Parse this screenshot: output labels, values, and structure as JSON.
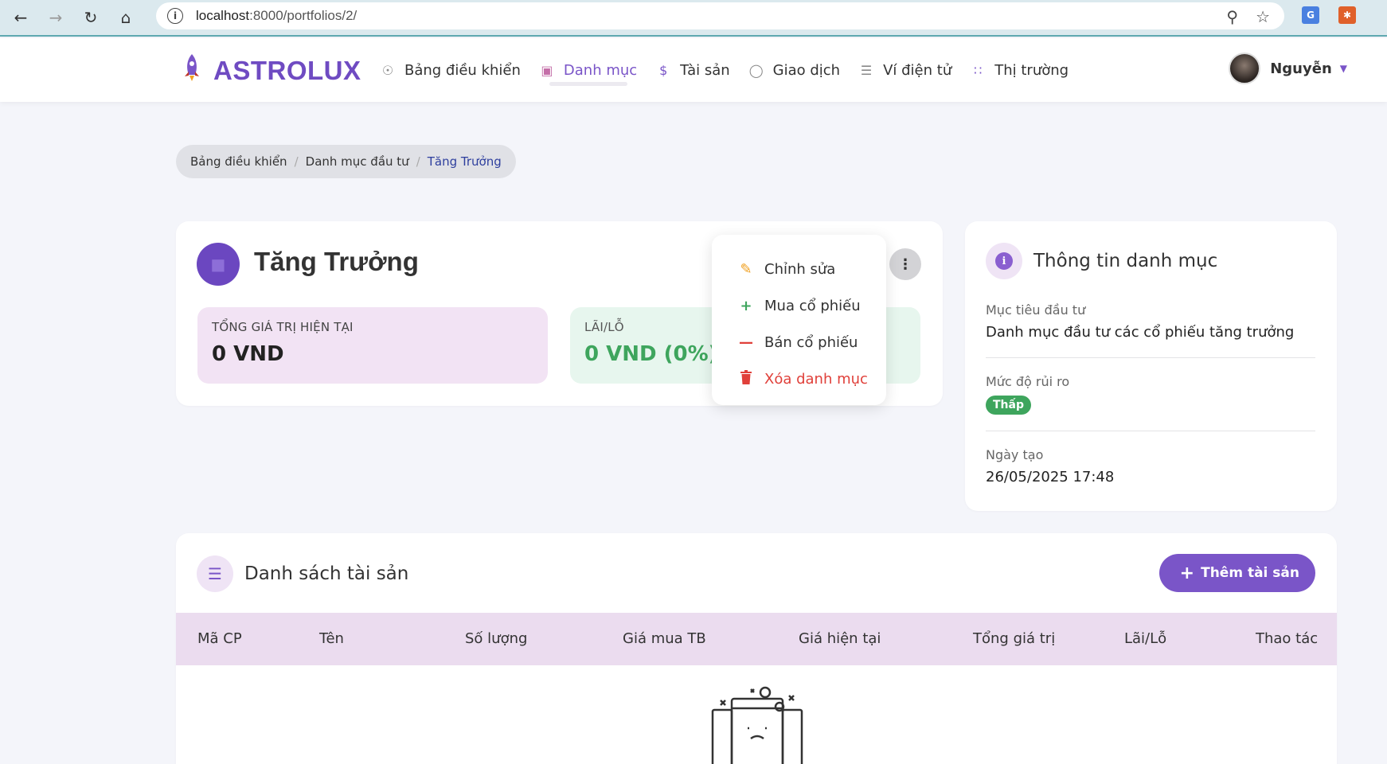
{
  "browser": {
    "url_host": "localhost",
    "url_rest": ":8000/portfolios/2/",
    "back_icon": "arrow-left-icon",
    "forward_icon": "arrow-right-icon",
    "reload_icon": "reload-icon",
    "home_icon": "home-icon"
  },
  "brand": {
    "name": "ASTROLUX",
    "color": "#6f4bc2"
  },
  "nav": {
    "items": [
      {
        "label": "Bảng điều khiển",
        "icon": "dashboard-icon"
      },
      {
        "label": "Danh mục",
        "icon": "folder-icon",
        "active": true
      },
      {
        "label": "Tài sản",
        "icon": "money-bag-icon"
      },
      {
        "label": "Giao dịch",
        "icon": "coin-icon"
      },
      {
        "label": "Ví điện tử",
        "icon": "wallet-icon"
      },
      {
        "label": "Thị trường",
        "icon": "chart-icon"
      }
    ],
    "user_name": "Nguyễn"
  },
  "breadcrumb": {
    "items": [
      "Bảng điều khiển",
      "Danh mục đầu tư"
    ],
    "current": "Tăng Trưởng"
  },
  "portfolio": {
    "title": "Tăng Trưởng",
    "total_label": "TỔNG GIÁ TRỊ HIỆN TẠI",
    "total_value": "0 VND",
    "pl_label": "LÃI/LỖ",
    "pl_value": "0 VND (0%)"
  },
  "dropdown": {
    "edit": "Chỉnh sửa",
    "buy": "Mua cổ phiếu",
    "sell": "Bán cổ phiếu",
    "delete": "Xóa danh mục"
  },
  "info": {
    "title": "Thông tin danh mục",
    "goal_label": "Mục tiêu đầu tư",
    "goal_value": "Danh mục đầu tư các cổ phiếu tăng trưởng",
    "risk_label": "Mức độ rủi ro",
    "risk_value": "Thấp",
    "created_label": "Ngày tạo",
    "created_value": "26/05/2025 17:48"
  },
  "assets": {
    "title": "Danh sách tài sản",
    "add_button": "Thêm tài sản",
    "columns": [
      "Mã CP",
      "Tên",
      "Số lượng",
      "Giá mua TB",
      "Giá hiện tại",
      "Tổng giá trị",
      "Lãi/Lỗ",
      "Thao tác"
    ]
  },
  "colors": {
    "accent": "#7a55c8",
    "success": "#3ea55d",
    "danger": "#e0403a",
    "warning": "#f0a020"
  }
}
